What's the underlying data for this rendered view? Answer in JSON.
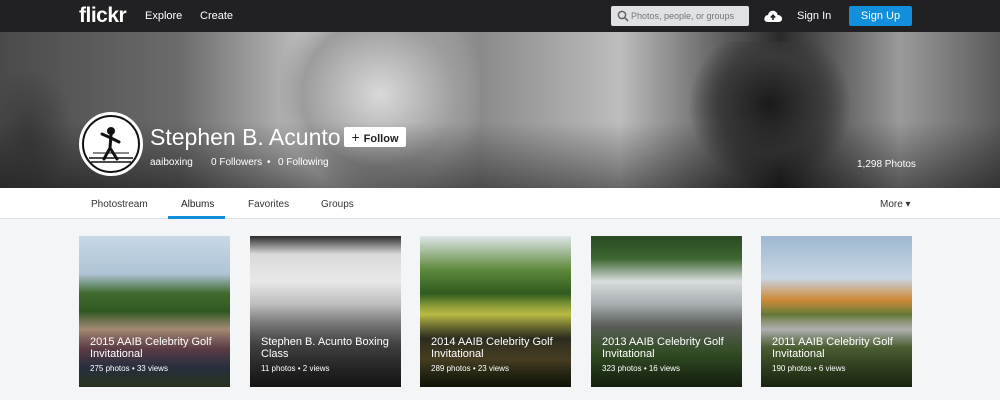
{
  "topbar": {
    "logo": "flickr",
    "explore": "Explore",
    "create": "Create",
    "search_placeholder": "Photos, people, or groups",
    "sign_in": "Sign In",
    "sign_up": "Sign Up"
  },
  "profile": {
    "name": "Stephen B. Acunto",
    "follow": "Follow",
    "username": "aaiboxing",
    "followers": "0 Followers",
    "following": "0 Following",
    "separator": "•",
    "photos_count": "1,298 Photos"
  },
  "tabs": {
    "photostream": "Photostream",
    "albums": "Albums",
    "favorites": "Favorites",
    "groups": "Groups",
    "more": "More ▾"
  },
  "albums": [
    {
      "title": "2015 AAIB Celebrity Golf Invitational",
      "stats": "275 photos  •  33 views"
    },
    {
      "title": "Stephen B. Acunto Boxing Class",
      "stats": "11 photos  •  2 views"
    },
    {
      "title": "2014 AAIB Celebrity Golf Invitational",
      "stats": "289 photos  •  23 views"
    },
    {
      "title": "2013 AAIB Celebrity Golf Invitational",
      "stats": "323 photos  •  16 views"
    },
    {
      "title": "2011 AAIB Celebrity Golf Invitational",
      "stats": "190 photos  •  6 views"
    }
  ],
  "colors": {
    "accent": "#128fdc",
    "topbar": "#212124"
  }
}
